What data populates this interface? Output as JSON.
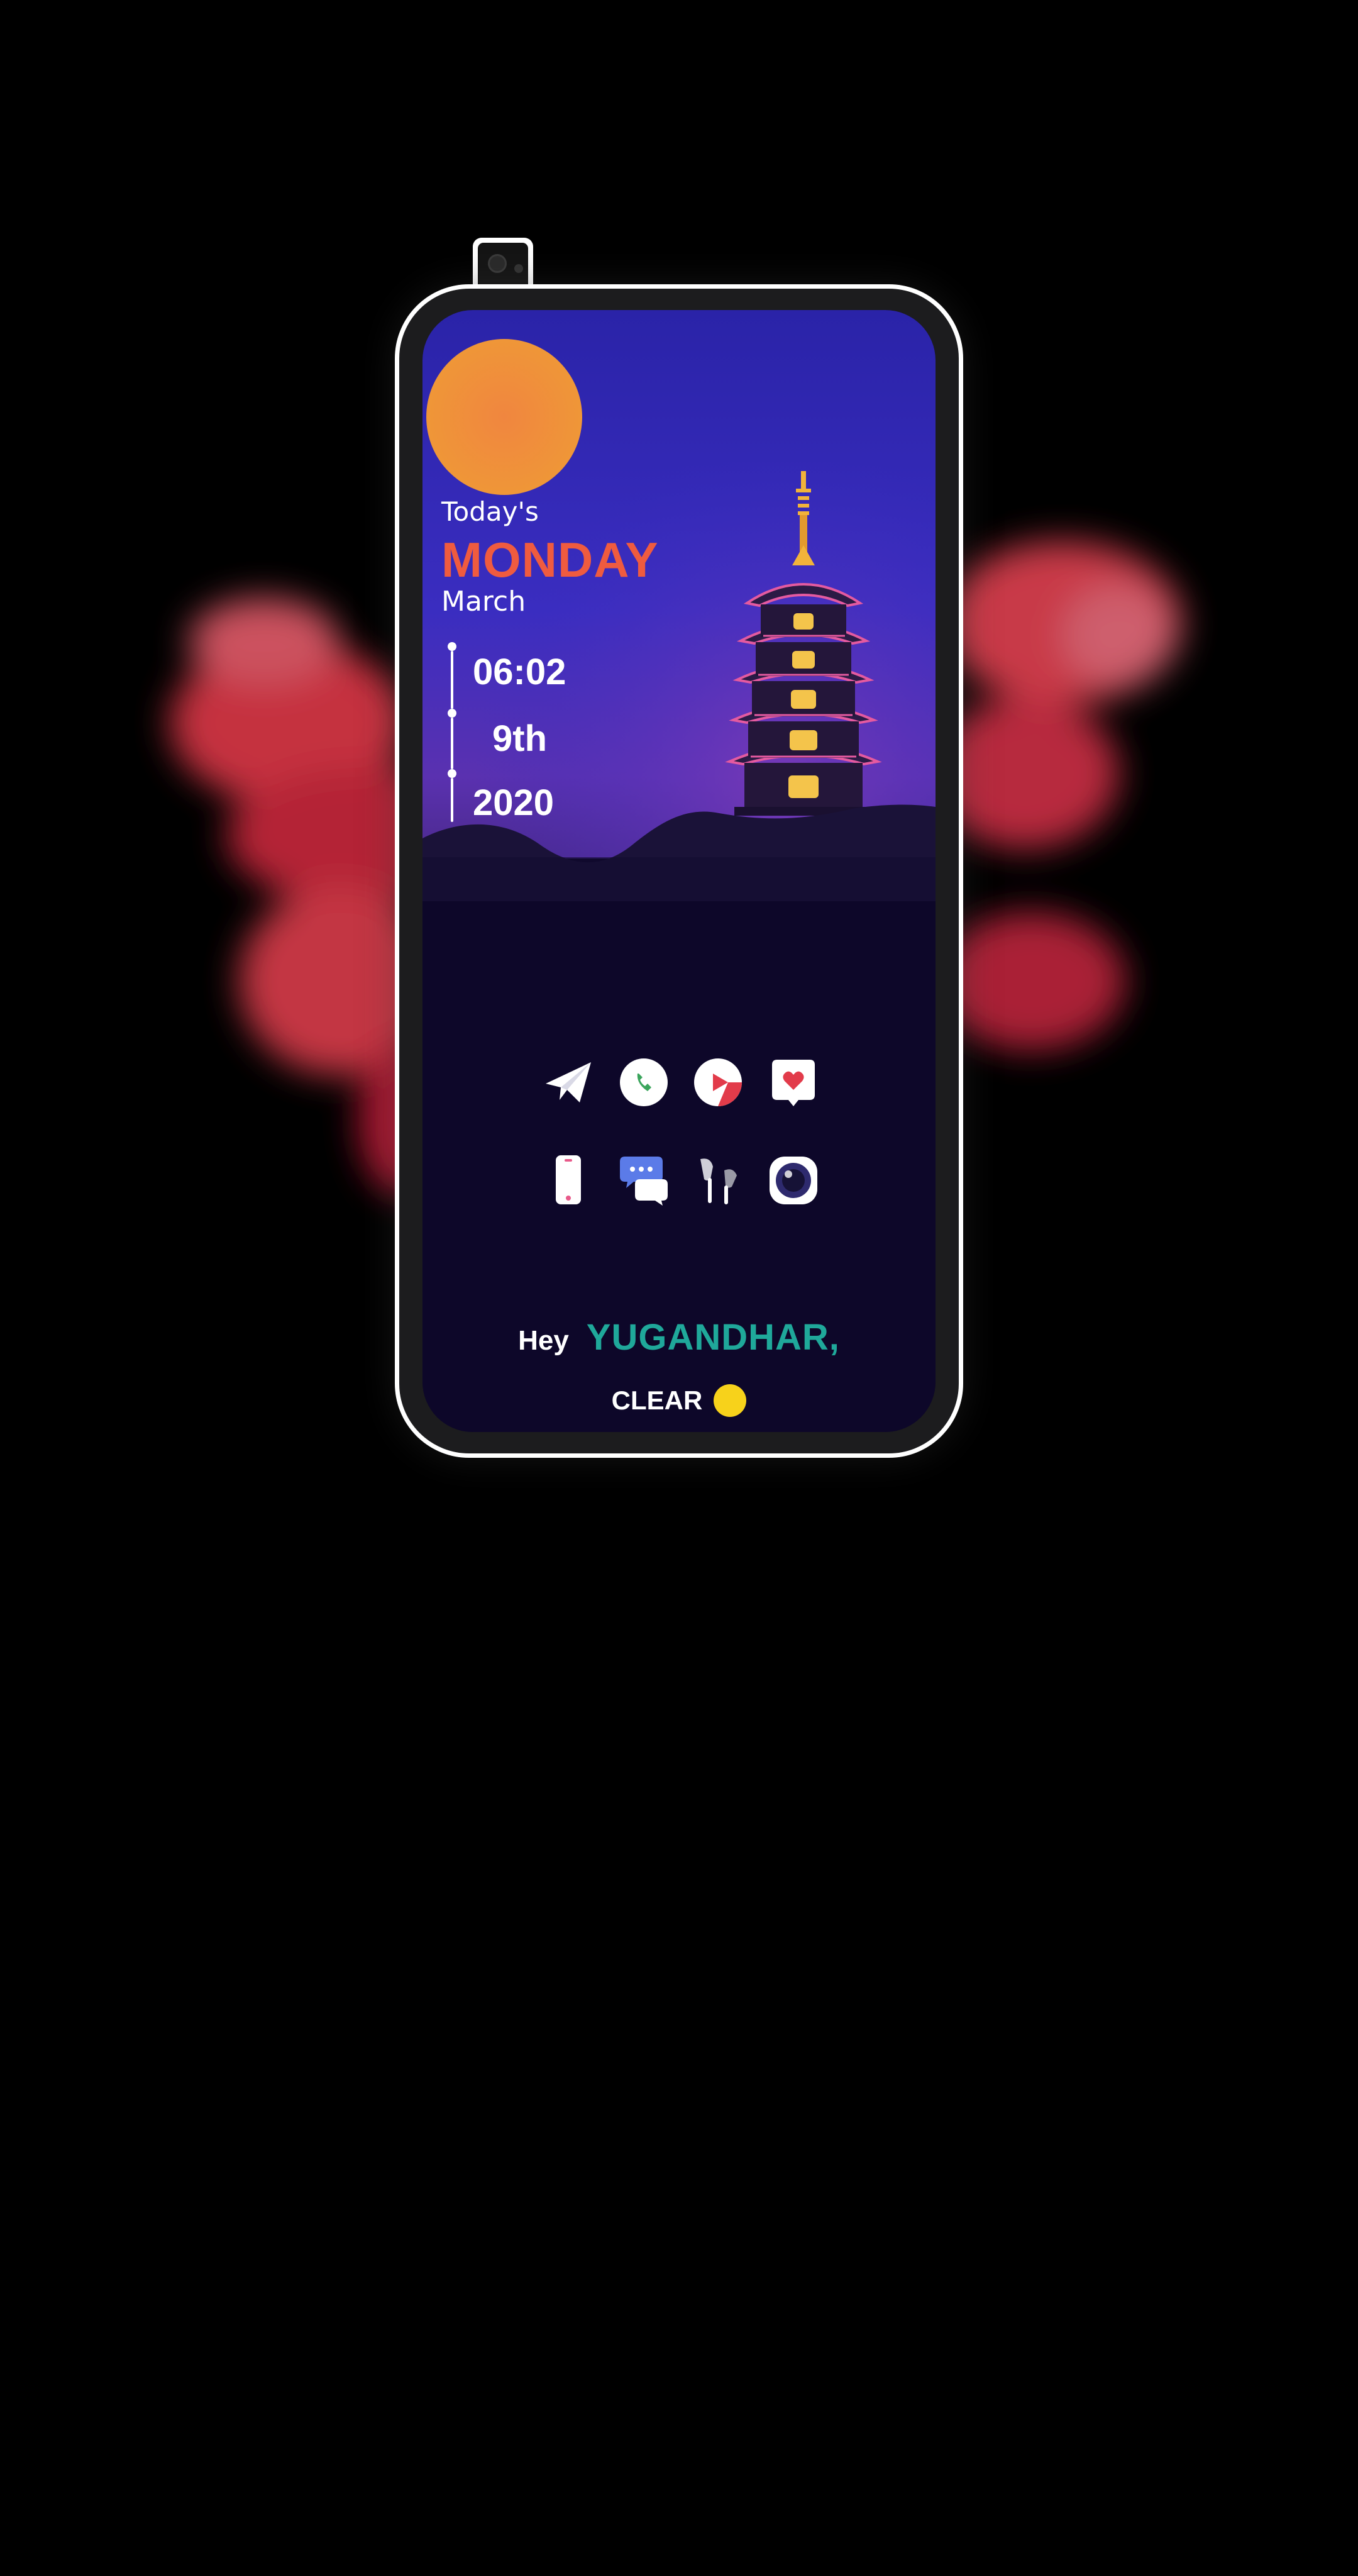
{
  "widget": {
    "todays_label": "Today's",
    "day_name": "MONDAY",
    "month": "March",
    "time": "06:02",
    "date": "9th",
    "year": "2020"
  },
  "dock": {
    "row1": [
      {
        "name": "telegram",
        "icon": "paper-plane-icon"
      },
      {
        "name": "phone",
        "icon": "phone-icon"
      },
      {
        "name": "youtube",
        "icon": "play-icon"
      },
      {
        "name": "favorites",
        "icon": "heart-message-icon"
      }
    ],
    "row2": [
      {
        "name": "device",
        "icon": "smartphone-icon"
      },
      {
        "name": "messages",
        "icon": "chat-bubbles-icon"
      },
      {
        "name": "music",
        "icon": "earphones-icon"
      },
      {
        "name": "camera",
        "icon": "camera-icon"
      }
    ]
  },
  "greeting": {
    "hey": "Hey",
    "name": "YUGANDHAR,"
  },
  "weather": {
    "condition": "CLEAR",
    "indicator_color": "#f7d21b"
  },
  "colors": {
    "accent_orange": "#ef5b3f",
    "accent_teal": "#1fa89a",
    "sky_top": "#2a1fa0",
    "night_ground": "#0d0729"
  }
}
